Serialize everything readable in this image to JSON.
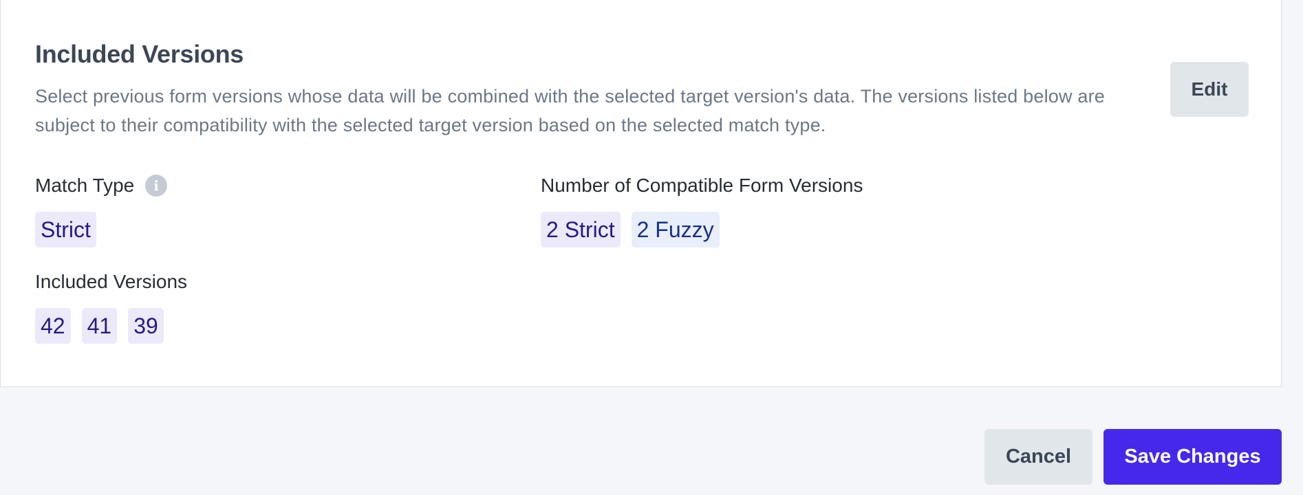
{
  "section": {
    "title": "Included Versions",
    "description": "Select previous form versions whose data will be combined with the selected target version's data. The versions listed below are subject to their compatibility with the selected target version based on the selected match type.",
    "edit_label": "Edit"
  },
  "match_type": {
    "label": "Match Type",
    "info_icon": "info-icon",
    "value": "Strict"
  },
  "compatible": {
    "label": "Number of Compatible Form Versions",
    "strict": "2 Strict",
    "fuzzy": "2 Fuzzy"
  },
  "included": {
    "label": "Included Versions",
    "versions": [
      "42",
      "41",
      "39"
    ]
  },
  "footer": {
    "cancel_label": "Cancel",
    "save_label": "Save Changes"
  },
  "colors": {
    "primary": "#4528ec",
    "chip_bg": "#ece9fb",
    "chip_text": "#261a86",
    "secondary_button": "#e1e6ea"
  }
}
